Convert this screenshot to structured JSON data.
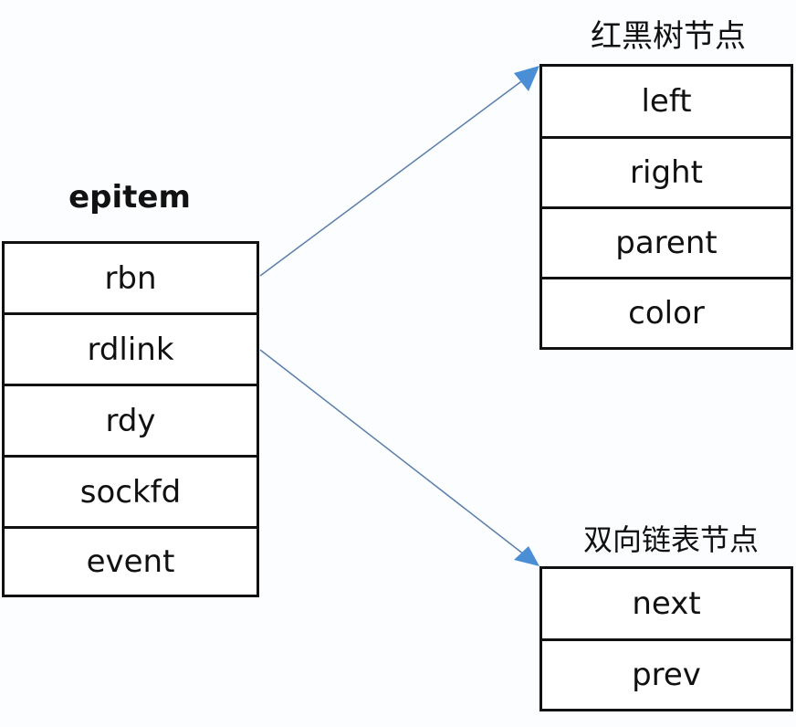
{
  "epitem": {
    "title": "epitem",
    "fields": [
      "rbn",
      "rdlink",
      "rdy",
      "sockfd",
      "event"
    ]
  },
  "rb_node": {
    "title": "红黑树节点",
    "fields": [
      "left",
      "right",
      "parent",
      "color"
    ]
  },
  "list_node": {
    "title": "双向链表节点",
    "fields": [
      "next",
      "prev"
    ]
  },
  "connections": [
    {
      "from": "epitem.rbn",
      "to": "rb_node"
    },
    {
      "from": "epitem.rdlink",
      "to": "list_node"
    }
  ],
  "colors": {
    "arrow_line": "#5b7fa8",
    "arrow_head": "#4a8fd6",
    "border": "#111111"
  }
}
